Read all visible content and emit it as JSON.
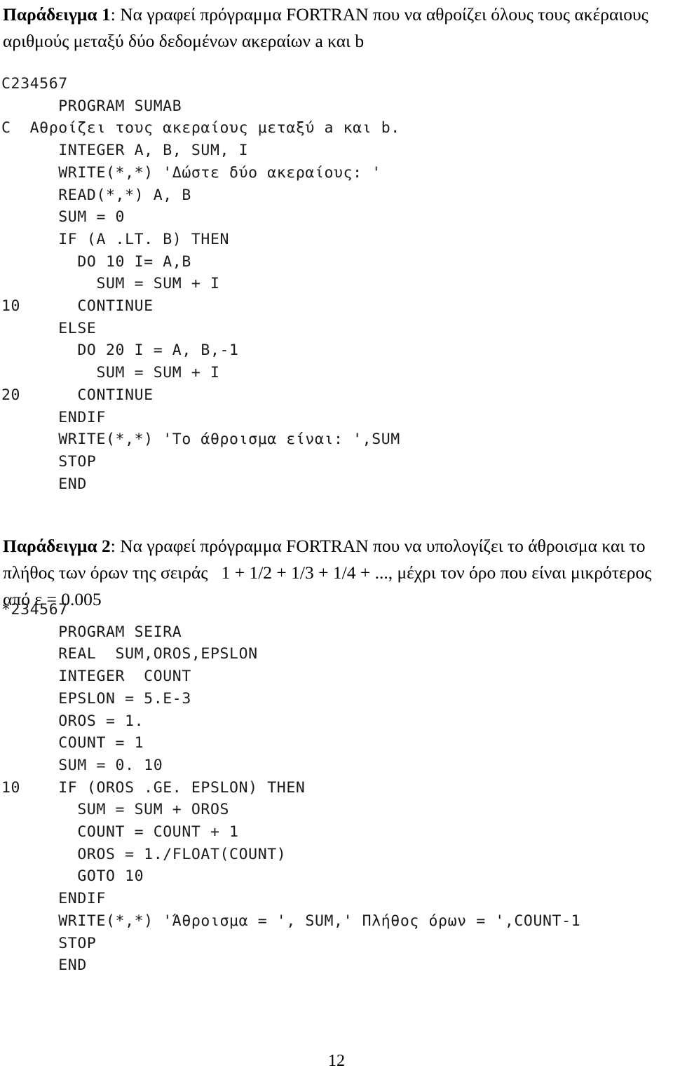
{
  "document": {
    "page_number": "12"
  },
  "example1": {
    "lead": "Παράδειγμα 1",
    "body": ": Να γραφεί πρόγραμμα FORTRAN που να αθροίζει όλους τους ακέραιους αριθμούς μεταξύ δύο δεδομένων ακεραίων a και b",
    "code_lines": [
      "C234567",
      "      PROGRAM SUMAB",
      "C  Αθροίζει τους ακεραίους μεταξύ a και b.",
      "      INTEGER A, B, SUM, I",
      "      WRITE(*,*) 'Δώστε δύο ακεραίους: '",
      "      READ(*,*) A, B",
      "      SUM = 0",
      "      IF (A .LT. B) THEN",
      "        DO 10 I= A,B",
      "          SUM = SUM + I",
      "10      CONTINUE",
      "      ELSE",
      "        DO 20 I = A, B,-1",
      "          SUM = SUM + I",
      "20      CONTINUE",
      "      ENDIF",
      "      WRITE(*,*) 'Το άθροισμα είναι: ',SUM",
      "      STOP",
      "      END"
    ]
  },
  "example2": {
    "lead": "Παράδειγμα 2",
    "body": ": Να γραφεί πρόγραμμα FORTRAN που να υπολογίζει το άθροισμα και το πλήθος των όρων της σειράς   1 + 1/2 + 1/3 + 1/4 + ..., μέχρι τον όρο που είναι μικρότερος από ε = 0.005",
    "code_lines": [
      "*234567",
      "      PROGRAM SEIRA",
      "      REAL  SUM,OROS,EPSLON",
      "      INTEGER  COUNT",
      "      EPSLON = 5.E-3",
      "      OROS = 1.",
      "      COUNT = 1",
      "      SUM = 0. 10",
      "10    IF (OROS .GE. EPSLON) THEN",
      "        SUM = SUM + OROS",
      "        COUNT = COUNT + 1",
      "        OROS = 1./FLOAT(COUNT)",
      "        GOTO 10",
      "      ENDIF",
      "      WRITE(*,*) 'Άθροισμα = ', SUM,' Πλήθος όρων = ',COUNT-1",
      "      STOP",
      "      END"
    ]
  }
}
